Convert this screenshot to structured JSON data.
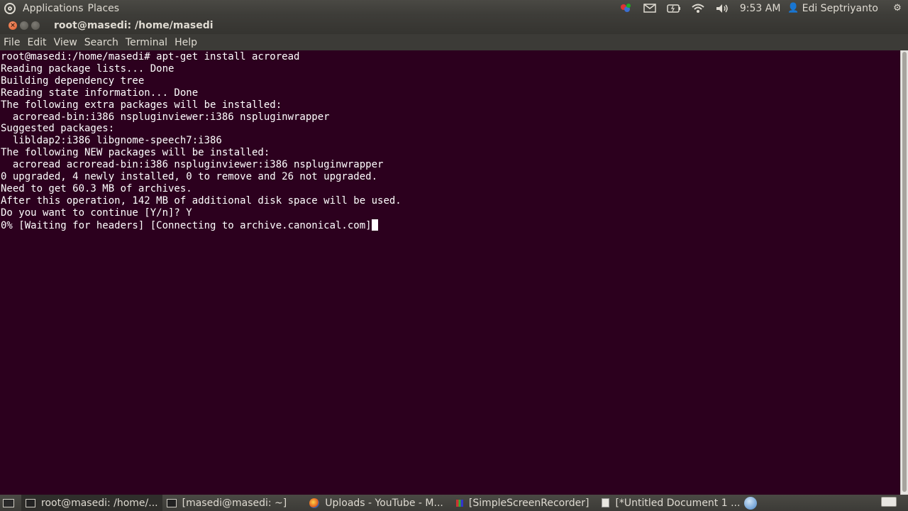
{
  "top_panel": {
    "menus": [
      "Applications",
      "Places"
    ],
    "clock": "9:53 AM",
    "user": "Edi Septriyanto"
  },
  "window": {
    "title": "root@masedi: /home/masedi",
    "menubar": [
      "File",
      "Edit",
      "View",
      "Search",
      "Terminal",
      "Help"
    ]
  },
  "terminal": {
    "lines": [
      "root@masedi:/home/masedi# apt-get install acroread",
      "Reading package lists... Done",
      "Building dependency tree",
      "Reading state information... Done",
      "The following extra packages will be installed:",
      "  acroread-bin:i386 nspluginviewer:i386 nspluginwrapper",
      "Suggested packages:",
      "  libldap2:i386 libgnome-speech7:i386",
      "The following NEW packages will be installed:",
      "  acroread acroread-bin:i386 nspluginviewer:i386 nspluginwrapper",
      "0 upgraded, 4 newly installed, 0 to remove and 26 not upgraded.",
      "Need to get 60.3 MB of archives.",
      "After this operation, 142 MB of additional disk space will be used.",
      "Do you want to continue [Y/n]? Y",
      "0% [Waiting for headers] [Connecting to archive.canonical.com]"
    ]
  },
  "taskbar": {
    "tasks": [
      {
        "label": "root@masedi: /home/...",
        "icon": "terminal-icon",
        "active": true
      },
      {
        "label": "[masedi@masedi: ~]",
        "icon": "terminal-icon",
        "active": false
      },
      {
        "label": "Uploads - YouTube - M...",
        "icon": "firefox-icon",
        "active": false
      },
      {
        "label": "[SimpleScreenRecorder]",
        "icon": "recorder-icon",
        "active": false
      },
      {
        "label": "[*Untitled Document 1 ...",
        "icon": "document-icon",
        "active": false
      }
    ]
  },
  "colors": {
    "terminal_bg": "#2c001e",
    "panel_bg": "#3c3b37",
    "close_button": "#e05a26"
  }
}
